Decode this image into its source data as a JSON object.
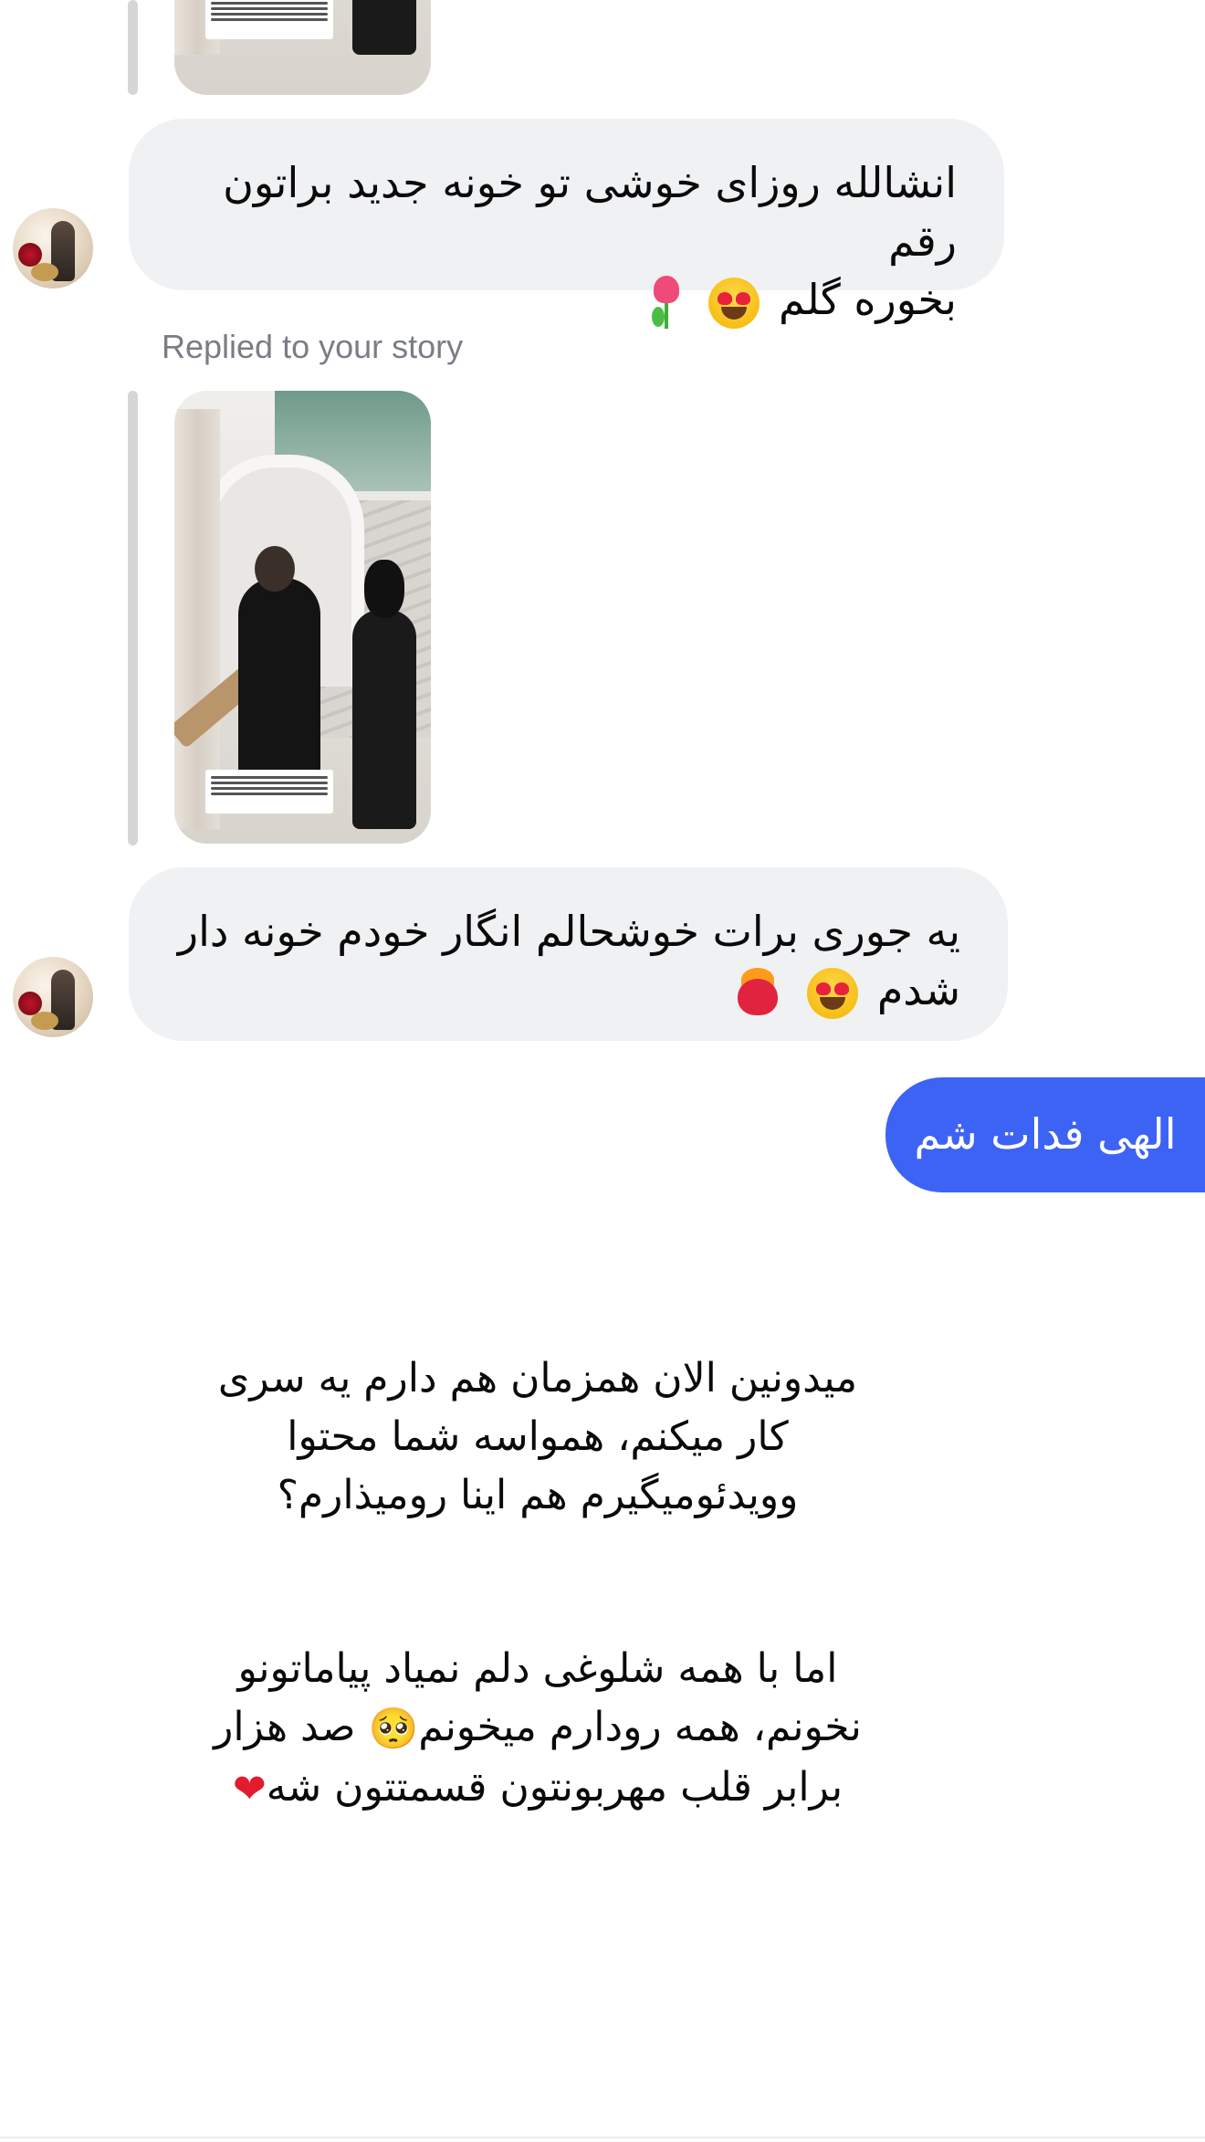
{
  "conversation": {
    "replied_label": "Replied to your story",
    "messages": [
      {
        "id": "m1",
        "text": "انشالله روزای خوشی تو خونه جدید براتون رقم",
        "text_line2": "بخوره گلم",
        "emojis": [
          "heart-eyes",
          "tulip"
        ]
      },
      {
        "id": "m2",
        "text": "یه جوری برات خوشحالم انگار خودم خونه دار",
        "text_line2": "شدم",
        "emojis": [
          "heart-eyes",
          "heart-on-fire"
        ]
      },
      {
        "id": "m3",
        "text": "الهی فدات شم"
      }
    ],
    "story_text": {
      "p1_line1": "میدونین الان همزمان هم دارم یه سری",
      "p1_line2": "کار میکنم، همواسه شما محتوا",
      "p1_line3": "وویدئومیگیرم هم اینا رومیذارم؟",
      "p2_line1": "اما با همه شلوغی دلم نمیاد پیاماتونو",
      "p2_line2a": "نخونم، همه رودارم میخونم",
      "p2_line2b": " صد هزار",
      "p2_line3": "برابر قلب مهربونتون قسمتتون شه",
      "emoji_pleading": "🥺",
      "emoji_heart": "❤"
    }
  },
  "colors": {
    "incoming_bubble": "#f0f1f3",
    "outgoing_bubble": "#3d63f5",
    "replied_label": "#7a7d85"
  }
}
